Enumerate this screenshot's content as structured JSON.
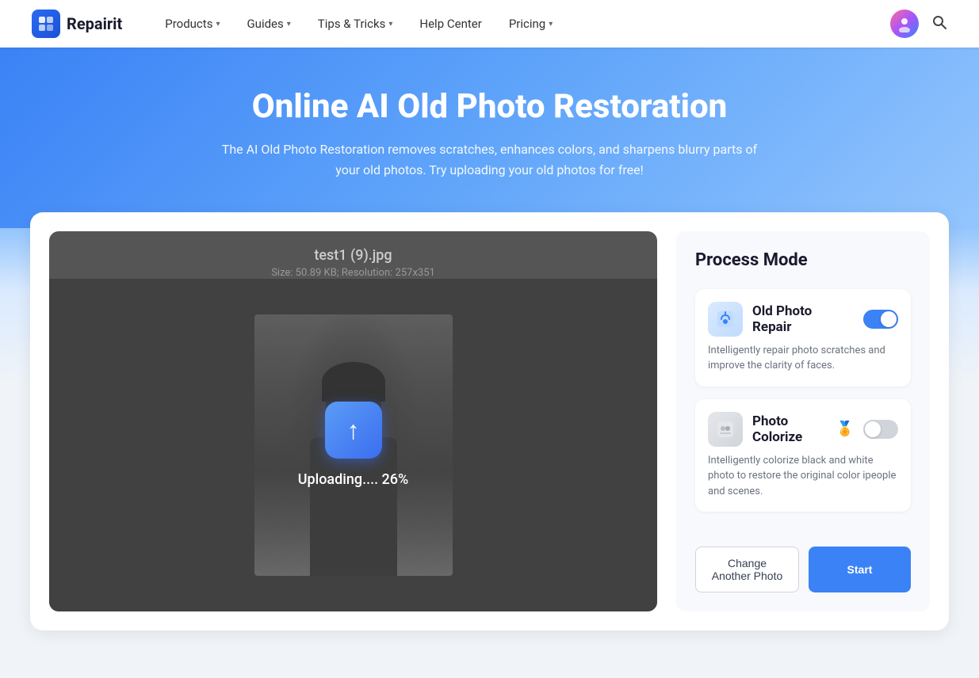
{
  "nav": {
    "logo_text": "Repairit",
    "logo_icon": "R",
    "items": [
      {
        "label": "Products",
        "has_chevron": true
      },
      {
        "label": "Guides",
        "has_chevron": true
      },
      {
        "label": "Tips & Tricks",
        "has_chevron": true
      },
      {
        "label": "Help Center",
        "has_chevron": false
      },
      {
        "label": "Pricing",
        "has_chevron": true
      }
    ]
  },
  "hero": {
    "title": "Online AI Old Photo Restoration",
    "subtitle": "The AI Old Photo Restoration removes scratches, enhances colors, and sharpens blurry parts of your old photos. Try uploading your old photos for free!"
  },
  "photo": {
    "filename": "test1 (9).jpg",
    "fileinfo": "Size: 50.89 KB; Resolution: 257x351",
    "upload_progress": "Uploading.... 26%"
  },
  "process": {
    "title": "Process Mode",
    "options": [
      {
        "label": "Old Photo Repair",
        "icon": "🔧",
        "icon_type": "repair",
        "toggle_on": true,
        "description": "Intelligently repair photo scratches and improve the clarity of faces.",
        "badge": null
      },
      {
        "label": "Photo Colorize",
        "icon": "🎨",
        "icon_type": "colorize",
        "toggle_on": false,
        "description": "Intelligently colorize black and white photo to restore the original color ipeople and scenes.",
        "badge": "🏅"
      }
    ],
    "btn_change": "Change Another Photo",
    "btn_start": "Start"
  }
}
